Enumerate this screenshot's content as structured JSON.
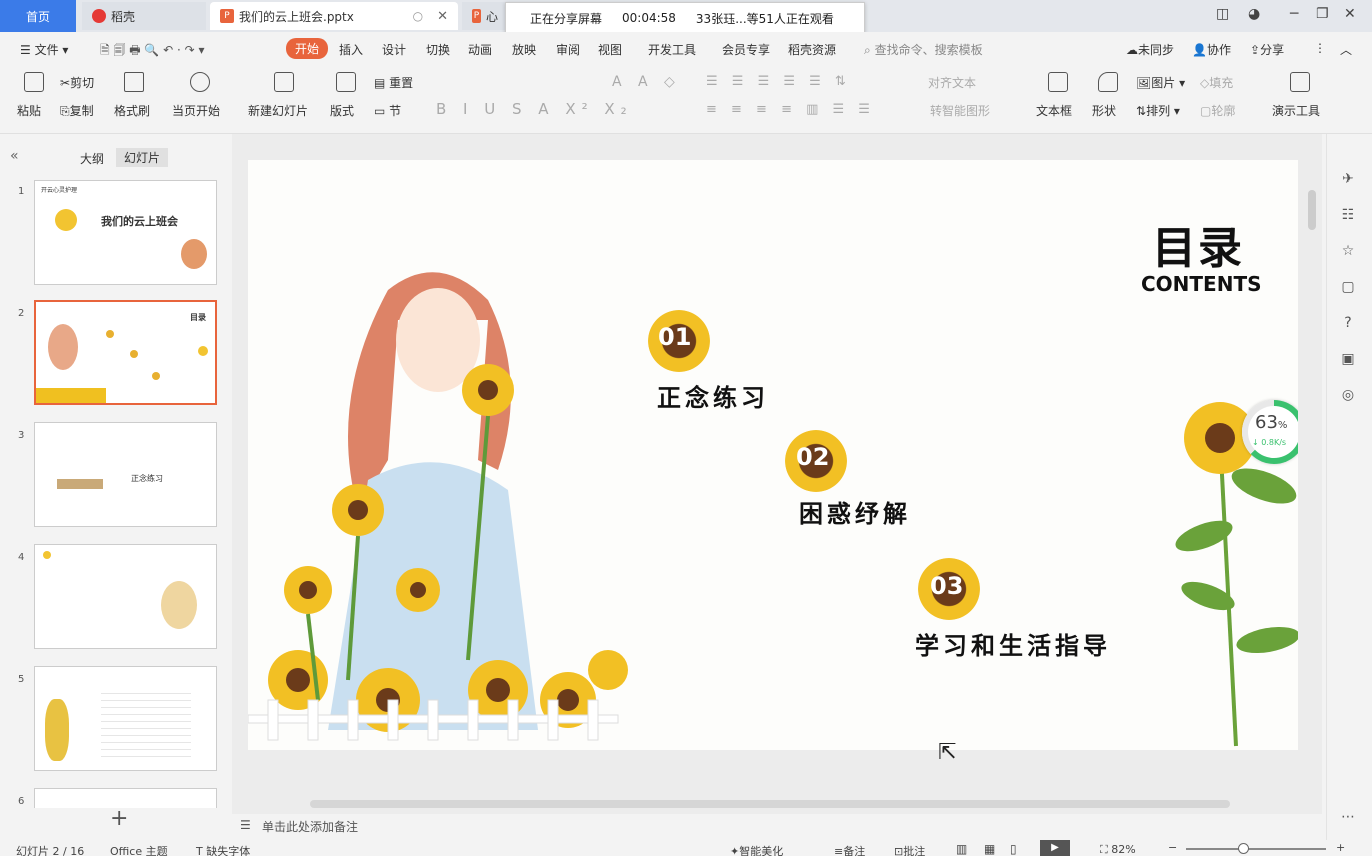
{
  "titlebar": {
    "home_tab": "首页",
    "daoke_tab": "稻壳",
    "doc_tab": "我们的云上班会.pptx",
    "doc2_tab": "心",
    "share_status": "正在分享屏幕",
    "share_time": "00:04:58",
    "viewers": "33张珏...等51人正在观看"
  },
  "menu": {
    "file": "文件",
    "tabs": [
      "开始",
      "插入",
      "设计",
      "切换",
      "动画",
      "放映",
      "审阅",
      "视图",
      "开发工具",
      "会员专享",
      "稻壳资源"
    ],
    "search_placeholder": "查找命令、搜索模板",
    "sync": "未同步",
    "collab": "协作",
    "share": "分享"
  },
  "ribbon": {
    "paste": "粘贴",
    "cut": "剪切",
    "copy": "复制",
    "format_painter": "格式刷",
    "play_from_current": "当页开始",
    "new_slide": "新建幻灯片",
    "layout": "版式",
    "reset": "重置",
    "section": "节",
    "align_text": "对齐文本",
    "smart_art": "转智能图形",
    "textbox": "文本框",
    "shape": "形状",
    "picture": "图片",
    "fill": "填充",
    "arrange": "排列",
    "outline": "轮廓",
    "present_tools": "演示工具"
  },
  "leftpanel": {
    "outline_tab": "大纲",
    "slides_tab": "幻灯片",
    "thumb1_title": "我们的云上班会",
    "thumb1_header": "开云心灵护理",
    "thumb2_title": "目录",
    "thumb3_text": "正念练习",
    "slide_numbers": [
      "1",
      "2",
      "3",
      "4",
      "5",
      "6"
    ]
  },
  "slide": {
    "title": "目录",
    "subtitle": "CONTENTS",
    "items": [
      {
        "num": "01",
        "label": "正念练习"
      },
      {
        "num": "02",
        "label": "困惑纾解"
      },
      {
        "num": "03",
        "label": "学习和生活指导"
      }
    ],
    "progress_value": "63",
    "progress_unit": "%",
    "progress_fraction": 0.63,
    "speed": "↓ 0.8K/s"
  },
  "notes": {
    "placeholder": "单击此处添加备注"
  },
  "statusbar": {
    "slide_index": "幻灯片 2 / 16",
    "theme": "Office 主题",
    "missing_fonts": "缺失字体",
    "smart_beautify": "智能美化",
    "notes": "备注",
    "comments": "批注",
    "zoom": "82%"
  },
  "colors": {
    "accent": "#e8643c",
    "home_blue": "#3b7be8",
    "progress_green": "#3ac16e"
  }
}
